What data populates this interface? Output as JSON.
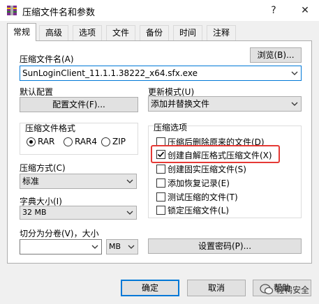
{
  "window": {
    "title": "压缩文件名和参数"
  },
  "titlebar_buttons": {
    "help": "?",
    "close": "✕"
  },
  "tabs": [
    "常规",
    "高级",
    "选项",
    "文件",
    "备份",
    "时间",
    "注释"
  ],
  "archive_name": {
    "label": "压缩文件名(A)",
    "value": "SunLoginClient_11.1.1.38222_x64.sfx.exe",
    "browse_button": "浏览(B)..."
  },
  "default_profile": {
    "label": "默认配置",
    "button": "配置文件(F)..."
  },
  "update_mode": {
    "label": "更新模式(U)",
    "value": "添加并替换文件"
  },
  "archive_format": {
    "label": "压缩文件格式",
    "options": [
      "RAR",
      "RAR4",
      "ZIP"
    ],
    "selected": "RAR"
  },
  "compression_method": {
    "label": "压缩方式(C)",
    "value": "标准"
  },
  "dictionary_size": {
    "label": "字典大小(I)",
    "value": "32 MB"
  },
  "split_volumes": {
    "label": "切分为分卷(V)，大小",
    "value": "",
    "unit": "MB"
  },
  "archive_options": {
    "label": "压缩选项",
    "items": [
      {
        "label": "压缩后删除原来的文件(D)",
        "checked": false
      },
      {
        "label": "创建自解压格式压缩文件(X)",
        "checked": true
      },
      {
        "label": "创建固实压缩文件(S)",
        "checked": false
      },
      {
        "label": "添加恢复记录(E)",
        "checked": false
      },
      {
        "label": "测试压缩的文件(T)",
        "checked": false
      },
      {
        "label": "锁定压缩文件(L)",
        "checked": false
      }
    ]
  },
  "set_password_button": "设置密码(P)...",
  "footer": {
    "ok": "确定",
    "cancel": "取消",
    "help": "帮助"
  },
  "watermark": {
    "text": "鞋鸭安全"
  },
  "colors": {
    "highlight": "#e53935",
    "accent": "#0078d7"
  }
}
